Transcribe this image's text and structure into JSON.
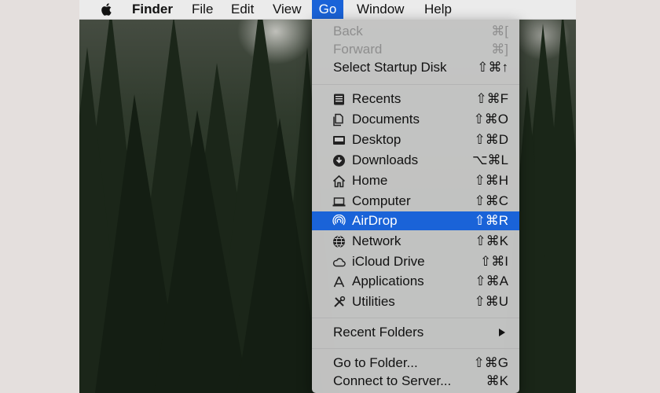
{
  "menubar": {
    "apple_icon": "apple-logo-icon",
    "items": [
      "Finder",
      "File",
      "Edit",
      "View",
      "Go",
      "Window",
      "Help"
    ],
    "active": "Go"
  },
  "go_menu": {
    "items": [
      {
        "label": "Back",
        "shortcut": "⌘[",
        "enabled": false
      },
      {
        "label": "Forward",
        "shortcut": "⌘]",
        "enabled": false
      },
      {
        "label": "Select Startup Disk",
        "shortcut": "⇧⌘↑"
      },
      {
        "label": "Recents",
        "shortcut": "⇧⌘F",
        "icon": "recents-icon"
      },
      {
        "label": "Documents",
        "shortcut": "⇧⌘O",
        "icon": "documents-icon"
      },
      {
        "label": "Desktop",
        "shortcut": "⇧⌘D",
        "icon": "desktop-icon"
      },
      {
        "label": "Downloads",
        "shortcut": "⌥⌘L",
        "icon": "downloads-icon"
      },
      {
        "label": "Home",
        "shortcut": "⇧⌘H",
        "icon": "home-icon"
      },
      {
        "label": "Computer",
        "shortcut": "⇧⌘C",
        "icon": "computer-icon"
      },
      {
        "label": "AirDrop",
        "shortcut": "⇧⌘R",
        "icon": "airdrop-icon",
        "selected": true
      },
      {
        "label": "Network",
        "shortcut": "⇧⌘K",
        "icon": "network-icon"
      },
      {
        "label": "iCloud Drive",
        "shortcut": "⇧⌘I",
        "icon": "icloud-icon"
      },
      {
        "label": "Applications",
        "shortcut": "⇧⌘A",
        "icon": "applications-icon"
      },
      {
        "label": "Utilities",
        "shortcut": "⇧⌘U",
        "icon": "utilities-icon"
      },
      {
        "label": "Recent Folders",
        "submenu": true
      },
      {
        "label": "Go to Folder...",
        "shortcut": "⇧⌘G"
      },
      {
        "label": "Connect to Server...",
        "shortcut": "⌘K"
      }
    ]
  },
  "colors": {
    "highlight": "#1a63d8",
    "menu_bg": "#cdcdcd",
    "disabled_text": "#8e8e8e"
  }
}
